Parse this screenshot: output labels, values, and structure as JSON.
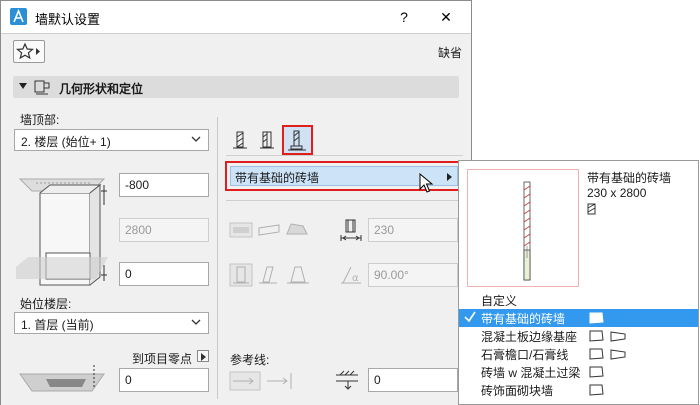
{
  "window": {
    "title": "墙默认设置",
    "help_label": "?",
    "close_label": "✕"
  },
  "toolbar": {
    "default_label": "缺省"
  },
  "section": {
    "title": "几何形状和定位"
  },
  "left": {
    "top_label": "墙顶部:",
    "top_select": "2. 楼层 (始位+ 1)",
    "top_offset": "-800",
    "height": "2800",
    "bottom_offset": "0",
    "home_story_label": "始位楼层:",
    "home_story_select": "1. 首层 (当前)",
    "to_project_zero_label": "到项目零点",
    "project_zero_value": "0"
  },
  "middle": {
    "structure_select": "带有基础的砖墙",
    "thickness": "230",
    "slant_angle": "90.00°",
    "ref_line_label": "参考线:",
    "ref_offset": "0"
  },
  "popup": {
    "preview_name": "带有基础的砖墙",
    "preview_size": "230 x 2800",
    "items": [
      {
        "label": "自定义",
        "checked": false,
        "icons": ""
      },
      {
        "label": "带有基础的砖墙",
        "checked": true,
        "icons": "wall-profile"
      },
      {
        "label": "混凝土板边缘基座",
        "checked": false,
        "icons": "wall-profile,wall-profile-slant"
      },
      {
        "label": "石膏檐口/石膏线",
        "checked": false,
        "icons": "wall-profile,wall-profile-slant"
      },
      {
        "label": "砖墙 w 混凝土过梁",
        "checked": false,
        "icons": "wall-profile"
      },
      {
        "label": "砖饰面砌块墙",
        "checked": false,
        "icons": "wall-profile"
      }
    ]
  },
  "colors": {
    "highlight_red": "#e01e1e",
    "selection_blue": "#3399ee",
    "dropdown_fill": "#cde3f8"
  }
}
